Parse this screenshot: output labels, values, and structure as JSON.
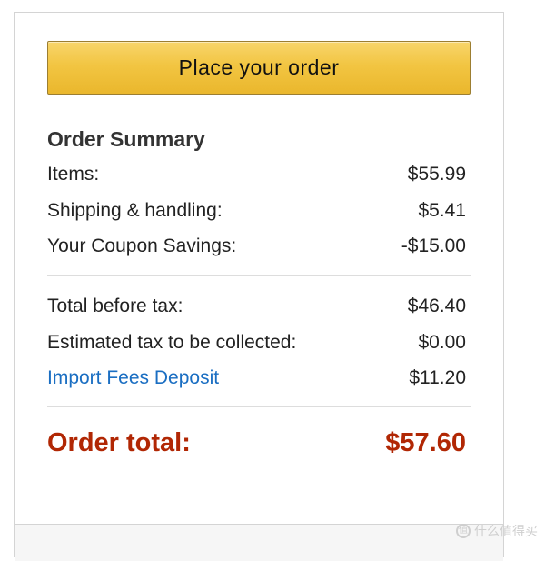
{
  "button": {
    "place_order_label": "Place your order"
  },
  "summary": {
    "title": "Order Summary",
    "rows_top": [
      {
        "label": "Items:",
        "value": "$55.99"
      },
      {
        "label": "Shipping & handling:",
        "value": "$5.41"
      },
      {
        "label": "Your Coupon Savings:",
        "value": "-$15.00"
      }
    ],
    "rows_mid": [
      {
        "label": "Total before tax:",
        "value": "$46.40"
      },
      {
        "label": "Estimated tax to be collected:",
        "value": "$0.00"
      },
      {
        "label": "Import Fees Deposit",
        "value": "$11.20"
      }
    ],
    "total": {
      "label": "Order total:",
      "value": "$57.60"
    }
  },
  "watermark": {
    "text": "值 什么值得买",
    "icon": "zhi-logo-icon"
  },
  "colors": {
    "button_fill": "#f2c542",
    "button_border": "#9c7e31",
    "total_red": "#b12704",
    "link_blue": "#1a6ec2"
  }
}
